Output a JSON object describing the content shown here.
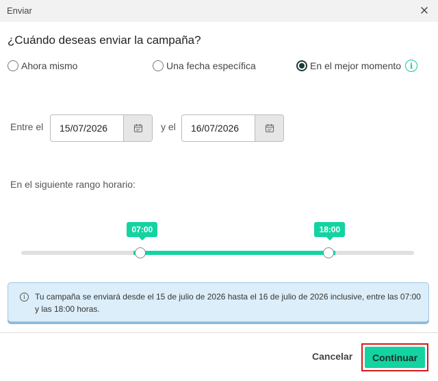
{
  "dialog": {
    "title": "Enviar",
    "close_icon": "close-icon"
  },
  "question": "¿Cuándo deseas enviar la campaña?",
  "options": [
    {
      "label": "Ahora mismo",
      "selected": false
    },
    {
      "label": "Una fecha específica",
      "selected": false
    },
    {
      "label": "En el mejor momento",
      "selected": true
    }
  ],
  "date_range": {
    "from_label": "Entre el",
    "from_value": "15/07/2026",
    "to_label": "y el",
    "to_value": "16/07/2026",
    "calendar_icon": "calendar-icon"
  },
  "time_range": {
    "label": "En el siguiente rango horario:",
    "start": "07:00",
    "end": "18:00",
    "start_fraction": 0.304,
    "end_fraction": 0.783,
    "accent_color": "#13d3a1"
  },
  "notice": {
    "icon": "info-icon",
    "text": "Tu campaña se enviará desde el 15 de julio de 2026 hasta el 16 de julio de 2026 inclusive, entre las 07:00 y las 18:00 horas."
  },
  "footer": {
    "cancel_label": "Cancelar",
    "continue_label": "Continuar"
  }
}
